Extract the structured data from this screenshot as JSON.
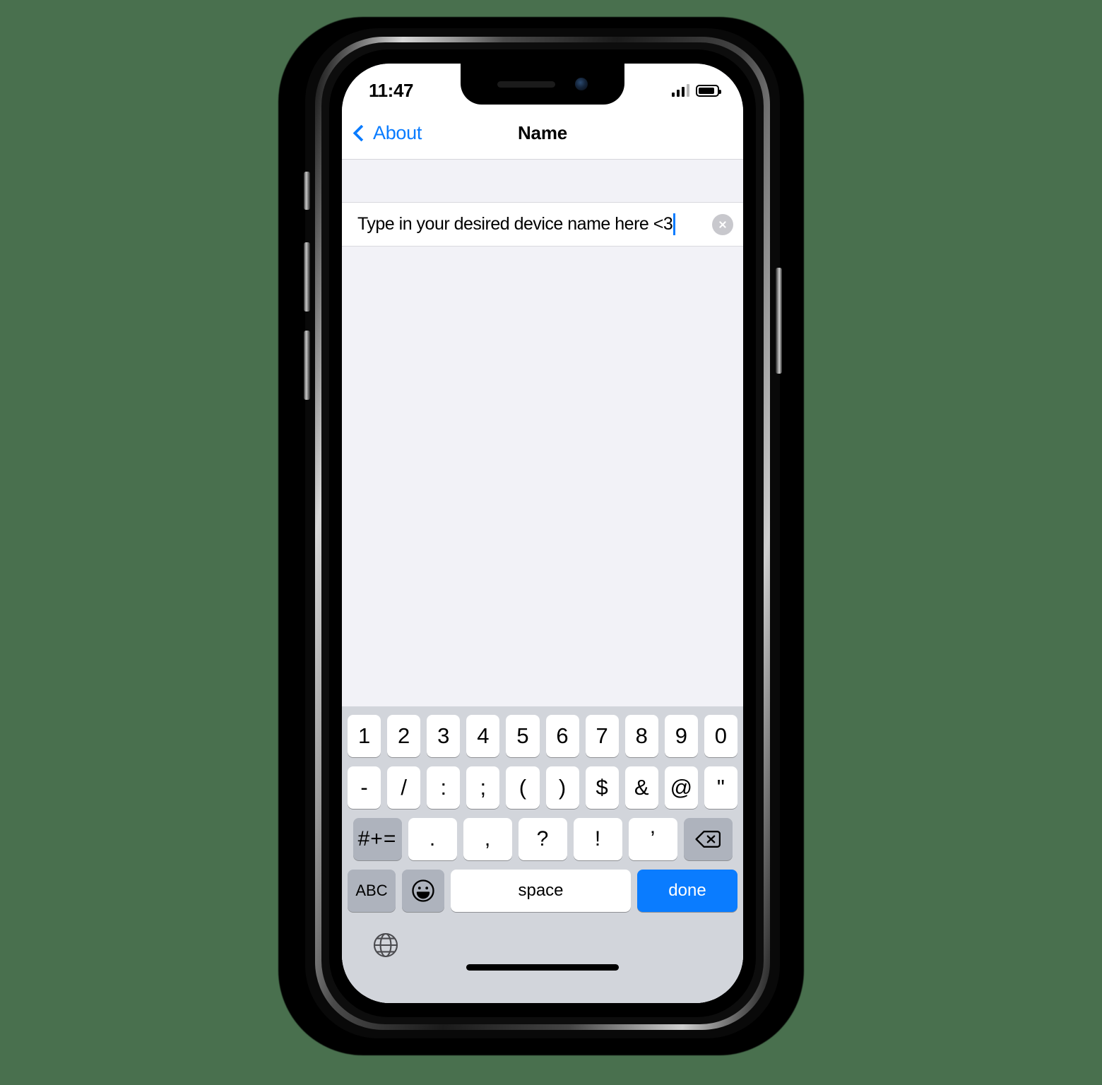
{
  "background_color": "#49704E",
  "accent_color": "#007AFF",
  "status_bar": {
    "time": "11:47",
    "signal_icon": "signal-bars-icon",
    "battery_icon": "battery-icon",
    "signal_bars_filled": 3,
    "signal_bars_total": 4,
    "battery_level_pct": 88
  },
  "navigation": {
    "back_icon": "chevron-left-icon",
    "back_label": "About",
    "title": "Name"
  },
  "text_field": {
    "value": "Type in your desired device name here <3",
    "placeholder": "Name",
    "clear_icon": "clear-circle-icon",
    "caret_visible": true
  },
  "keyboard": {
    "row_numbers": [
      "1",
      "2",
      "3",
      "4",
      "5",
      "6",
      "7",
      "8",
      "9",
      "0"
    ],
    "row_symbols": [
      "-",
      "/",
      ":",
      ";",
      "(",
      ")",
      "$",
      "&",
      "@",
      "\""
    ],
    "row_punct": {
      "shift_symbols_label": "#+=",
      "keys": [
        ".",
        ",",
        "?",
        "!",
        "’"
      ],
      "backspace_icon": "backspace-icon"
    },
    "row_bottom": {
      "abc_label": "ABC",
      "emoji_icon": "emoji-smiley-icon",
      "space_label": "space",
      "done_label": "done"
    },
    "globe_icon": "globe-icon",
    "home_indicator": "home-indicator"
  }
}
